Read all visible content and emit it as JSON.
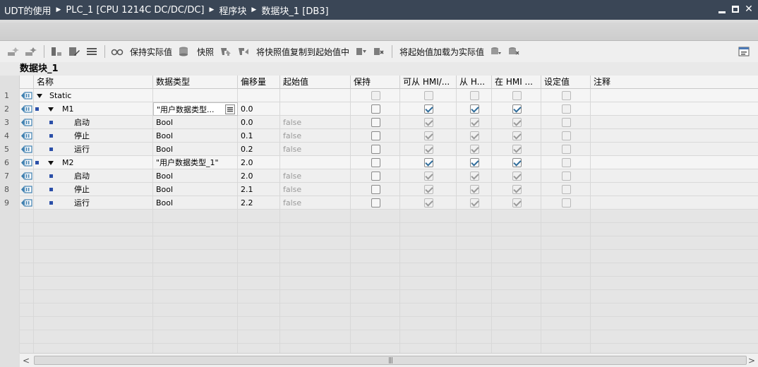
{
  "breadcrumb": [
    "UDT的使用",
    "PLC_1 [CPU 1214C DC/DC/DC]",
    "程序块",
    "数据块_1 [DB3]"
  ],
  "window_controls": {
    "minimize": "minimize-icon",
    "restore": "restore-icon",
    "close": "✕"
  },
  "toolbar": {
    "keep_actual": "保持实际值",
    "snapshot": "快照",
    "copy_snapshot_to_start": "将快照值复制到起始值中",
    "load_start_as_actual": "将起始值加载为实际值"
  },
  "block_title": "数据块_1",
  "columns": {
    "name": "名称",
    "datatype": "数据类型",
    "offset": "偏移量",
    "start": "起始值",
    "retain": "保持",
    "hmi_access": "可从 HMI/...",
    "hmi_visible": "从 H...",
    "hmi_setpoint": "在 HMI ...",
    "setpoint": "设定值",
    "comment": "注释"
  },
  "rows": [
    {
      "num": "1",
      "level": 0,
      "expand": true,
      "bullet": false,
      "name": "Static",
      "type": "",
      "offset": "",
      "start": "",
      "retain": false,
      "hmi1": false,
      "hmi2": false,
      "hmi3": false,
      "set": false,
      "enabled": false
    },
    {
      "num": "2",
      "level": 1,
      "expand": true,
      "bullet": true,
      "name": "M1",
      "type": "\"用户数据类型...",
      "offset": "0.0",
      "start": "",
      "retain": false,
      "hmi1": true,
      "hmi2": true,
      "hmi3": true,
      "set": false,
      "enabled": true,
      "editing": true
    },
    {
      "num": "3",
      "level": 2,
      "expand": false,
      "bullet": true,
      "name": "启动",
      "type": "Bool",
      "offset": "0.0",
      "start": "false",
      "retain": false,
      "hmi1": true,
      "hmi2": true,
      "hmi3": true,
      "set": false,
      "enabled": false
    },
    {
      "num": "4",
      "level": 2,
      "expand": false,
      "bullet": true,
      "name": "停止",
      "type": "Bool",
      "offset": "0.1",
      "start": "false",
      "retain": false,
      "hmi1": true,
      "hmi2": true,
      "hmi3": true,
      "set": false,
      "enabled": false
    },
    {
      "num": "5",
      "level": 2,
      "expand": false,
      "bullet": true,
      "name": "运行",
      "type": "Bool",
      "offset": "0.2",
      "start": "false",
      "retain": false,
      "hmi1": true,
      "hmi2": true,
      "hmi3": true,
      "set": false,
      "enabled": false
    },
    {
      "num": "6",
      "level": 1,
      "expand": true,
      "bullet": true,
      "name": "M2",
      "type": "\"用户数据类型_1\"",
      "offset": "2.0",
      "start": "",
      "retain": false,
      "hmi1": true,
      "hmi2": true,
      "hmi3": true,
      "set": false,
      "enabled": true
    },
    {
      "num": "7",
      "level": 2,
      "expand": false,
      "bullet": true,
      "name": "启动",
      "type": "Bool",
      "offset": "2.0",
      "start": "false",
      "retain": false,
      "hmi1": true,
      "hmi2": true,
      "hmi3": true,
      "set": false,
      "enabled": false
    },
    {
      "num": "8",
      "level": 2,
      "expand": false,
      "bullet": true,
      "name": "停止",
      "type": "Bool",
      "offset": "2.1",
      "start": "false",
      "retain": false,
      "hmi1": true,
      "hmi2": true,
      "hmi3": true,
      "set": false,
      "enabled": false
    },
    {
      "num": "9",
      "level": 2,
      "expand": false,
      "bullet": true,
      "name": "运行",
      "type": "Bool",
      "offset": "2.2",
      "start": "false",
      "retain": false,
      "hmi1": true,
      "hmi2": true,
      "hmi3": true,
      "set": false,
      "enabled": false
    }
  ],
  "scrollbar": {
    "left_arrow": "<",
    "right_arrow": ">",
    "grip": "|||"
  }
}
